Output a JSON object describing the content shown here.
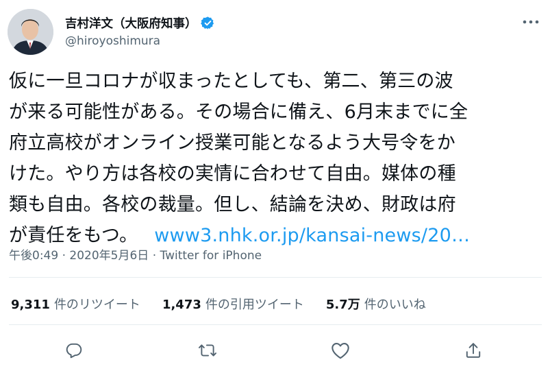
{
  "author": {
    "display_name": "吉村洋文（大阪府知事）",
    "handle": "@hiroyoshimura",
    "verified": true
  },
  "tweet": {
    "lines": [
      "仮に一旦コロナが収まったとしても、第二、第三の波",
      "が来る可能性がある。その場合に備え、6月末までに全",
      "府立高校がオンライン授業可能となるよう大号令をか",
      "けた。やり方は各校の実情に合わせて自由。媒体の種",
      "類も自由。各校の裁量。但し、結論を決め、財政は府"
    ],
    "last_line": "が責任をもつ。",
    "link_text": "www3.nhk.or.jp/kansai-news/20…"
  },
  "meta": {
    "time": "午後0:49",
    "separator": " · ",
    "date": "2020年5月6日",
    "source": "Twitter for iPhone"
  },
  "stats": {
    "retweets": {
      "count": "9,311",
      "label": "件のリツイート"
    },
    "quotes": {
      "count": "1,473",
      "label": "件の引用ツイート"
    },
    "likes": {
      "count": "5.7万",
      "label": "件のいいね"
    }
  },
  "colors": {
    "link": "#1d9bf0",
    "verified": "#1d9bf0",
    "secondary_text": "#536471",
    "icon": "#536471"
  },
  "icons": {
    "more": "more-dots-icon",
    "reply": "reply-icon",
    "retweet": "retweet-icon",
    "like": "heart-icon",
    "share": "share-icon"
  }
}
